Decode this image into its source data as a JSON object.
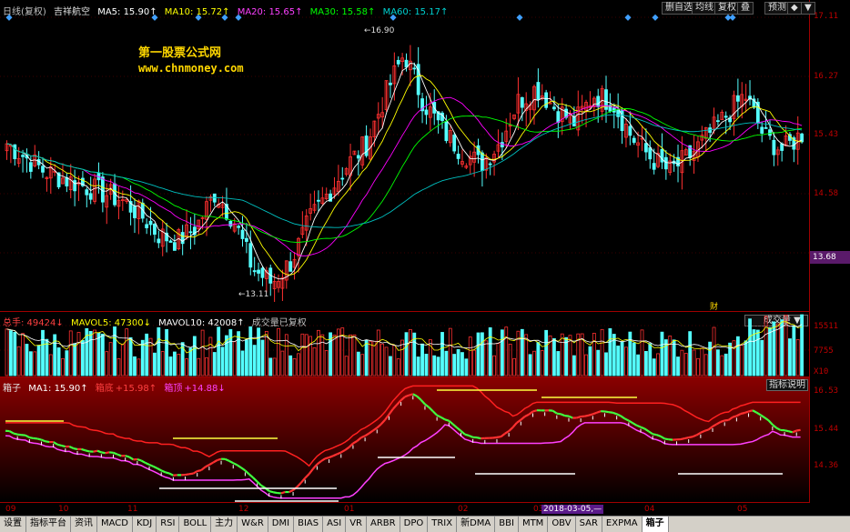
{
  "main_header": {
    "period": "日线(复权)",
    "stock": "吉祥航空",
    "ma5": "MA5: 15.90↑",
    "ma10": "MA10: 15.72↑",
    "ma20": "MA20: 15.65↑",
    "ma30": "MA30: 15.58↑",
    "ma60": "MA60: 15.17↑"
  },
  "toolbar": {
    "b1": "删自选",
    "b2": "均线",
    "b3": "复权",
    "b4": "叠",
    "b5": "预测",
    "b6": "◆",
    "b7": "▼"
  },
  "watermark": {
    "line1": "第一股票公式网",
    "line2": "www.chnmoney.com"
  },
  "annotations": {
    "high": "16.90",
    "low": "13.11",
    "cai": "财"
  },
  "main_axis": [
    "17.11",
    "16.27",
    "15.43",
    "14.58"
  ],
  "price_current": "13.68",
  "vol_header": {
    "total": "总手: 49424↓",
    "mavol5": "MAVOL5: 47300↓",
    "mavol10": "MAVOL10: 42008↑",
    "note": "成交量已复权"
  },
  "vol_dropdown": "成交量",
  "vol_axis": [
    "15511",
    "7755",
    "X10"
  ],
  "ind_header": {
    "name": "箱子",
    "ma1": "MA1: 15.90↑",
    "boxbottom_label": "箱底",
    "boxbottom_val": "+15.98↑",
    "boxtop_label": "箱顶",
    "boxtop_val": "+14.88↓"
  },
  "ind_button": "指标说明",
  "ind_axis": [
    "16.53",
    "15.44",
    "14.36"
  ],
  "x_axis": [
    "09",
    "10",
    "11",
    "12",
    "01",
    "02",
    "03",
    "04",
    "05"
  ],
  "cursor_date": "2018-03-05,—",
  "tabs": [
    "设置",
    "指标平台",
    "资讯",
    "MACD",
    "KDJ",
    "RSI",
    "BOLL",
    "主力",
    "W&R",
    "DMI",
    "BIAS",
    "ASI",
    "VR",
    "ARBR",
    "DPO",
    "TRIX",
    "新DMA",
    "BBI",
    "MTM",
    "OBV",
    "SAR",
    "EXPMA",
    "箱子"
  ],
  "colors": {
    "up": "#ff3030",
    "down": "#54ffff",
    "ma5": "#ffffff",
    "ma10": "#ffff00",
    "ma20": "#ff00ff",
    "ma30": "#00ff00",
    "ma60": "#00c0c0",
    "grid": "#a00000"
  },
  "chart_data": {
    "type": "line",
    "title": "",
    "series": [
      {
        "values": [
          15.3,
          15.1,
          14.9,
          14.8,
          14.7,
          14.6,
          14.5,
          14.3,
          14.0,
          13.9,
          14.1,
          14.6,
          14.2,
          13.5,
          13.3,
          13.6,
          14.2,
          14.6,
          15.0,
          15.3,
          16.0,
          16.6,
          15.9,
          15.5,
          15.2,
          15.0,
          15.3,
          15.9,
          16.1,
          15.8,
          15.6,
          16.0,
          15.9,
          15.4,
          15.1,
          14.9,
          15.1,
          15.4,
          15.7,
          16.0,
          15.4,
          15.2,
          15.44
        ]
      }
    ]
  }
}
